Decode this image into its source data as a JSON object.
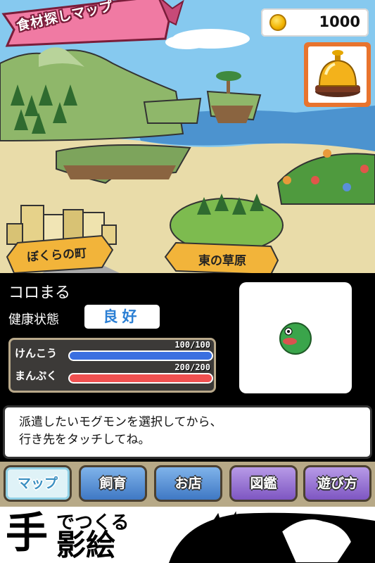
{
  "map": {
    "title": "食材探しマップ",
    "coins": "1000",
    "places": [
      {
        "name": "ぼくらの町"
      },
      {
        "name": "東の草原"
      }
    ]
  },
  "status": {
    "monster_name": "コロまる",
    "health_label": "健康状態",
    "health_value": "良好",
    "gauges": [
      {
        "label": "けんこう",
        "value_text": "100/100",
        "fraction": 1.0,
        "color": "#3a6fe0"
      },
      {
        "label": "まんぷく",
        "value_text": "200/200",
        "fraction": 1.0,
        "color": "#f05050"
      }
    ]
  },
  "message": {
    "line1": "派遣したいモグモンを選択してから、",
    "line2": "行き先をタッチしてね。"
  },
  "nav": {
    "items": [
      {
        "label": "マップ"
      },
      {
        "label": "飼育"
      },
      {
        "label": "お店"
      },
      {
        "label": "図鑑"
      },
      {
        "label": "遊び方"
      }
    ]
  },
  "ad": {
    "small": "でつくる",
    "big": "手",
    "big2": "影絵"
  },
  "colors": {
    "sky": "#86c9ef",
    "health_good": "#2b7fd4",
    "bell_frame": "#e8742e",
    "nav_bg": "#b7a987"
  }
}
